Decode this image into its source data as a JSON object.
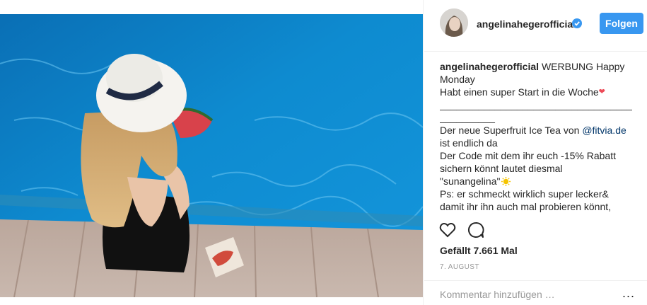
{
  "post": {
    "username": "angelinahegerofficial",
    "follow_label": "Folgen",
    "caption_lines": [
      "WERBUNG Happy",
      "Monday",
      "Habt einen super Start in die Woche",
      "______________________________________",
      "__________",
      "Der neue Superfruit Ice Tea von ",
      "ist endlich da",
      "Der Code mit dem ihr euch -15% Rabatt",
      "sichern könnt lautet diesmal",
      "\"sunangelina\"",
      "Ps: er schmeckt wirklich super lecker&",
      "damit ihr ihn auch mal probieren könnt,"
    ],
    "mention": "@fitvia.de",
    "likes": "Gefällt 7.661 Mal",
    "date": "7. AUGUST",
    "comment_placeholder": "Kommentar hinzufügen …",
    "more_label": "..."
  },
  "colors": {
    "follow_button": "#3897f0",
    "verified": "#3897f0",
    "mention": "#003569",
    "heart": "#ed4956"
  },
  "icons": {
    "verified": "verified-badge-icon",
    "like": "heart-outline-icon",
    "comment": "comment-bubble-icon",
    "heart_emoji": "red-heart-emoji",
    "sun_emoji": "sun-emoji"
  }
}
